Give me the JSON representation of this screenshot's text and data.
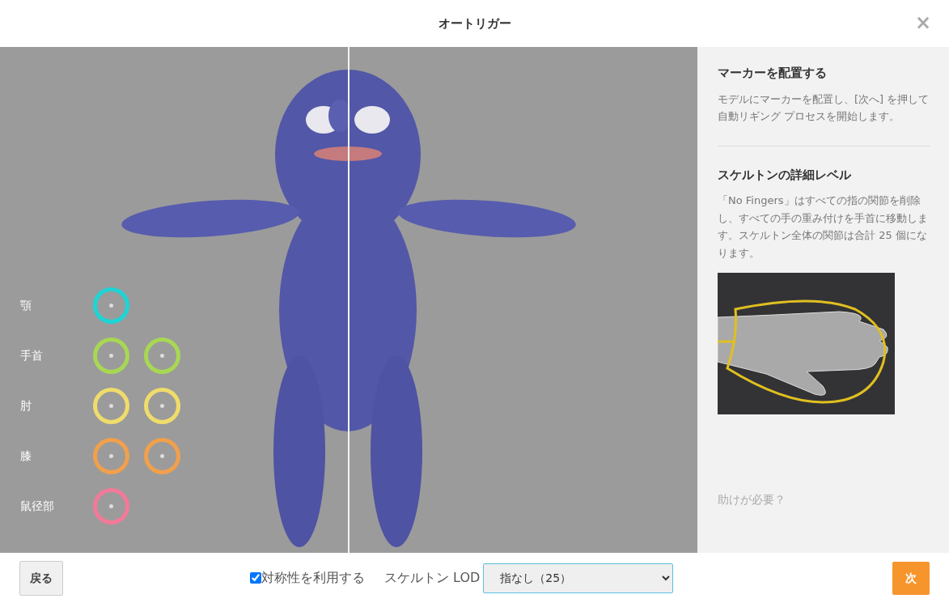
{
  "window": {
    "title": "オートリガー",
    "close": "×"
  },
  "markers": [
    {
      "label": "顎",
      "points": [
        {
          "color": "#1fd4d4"
        }
      ]
    },
    {
      "label": "手首",
      "points": [
        {
          "color": "#a8d853"
        },
        {
          "color": "#a8d853"
        }
      ]
    },
    {
      "label": "肘",
      "points": [
        {
          "color": "#efdc6b"
        },
        {
          "color": "#efdc6b"
        }
      ]
    },
    {
      "label": "膝",
      "points": [
        {
          "color": "#f1a04c"
        },
        {
          "color": "#f1a04c"
        }
      ]
    },
    {
      "label": "鼠径部",
      "points": [
        {
          "color": "#f27a98"
        }
      ]
    }
  ],
  "sidebar": {
    "sections": [
      {
        "title": "マーカーを配置する",
        "text": "モデルにマーカーを配置し、[次へ] を押して自動リギング プロセスを開始します。"
      },
      {
        "title": "スケルトンの詳細レベル",
        "text": "「No Fingers」はすべての指の関節を削除し、すべての手の重み付けを手首に移動します。スケルトン全体の関節は合計 25 個になります。"
      }
    ],
    "help_link": "助けが必要？"
  },
  "footer": {
    "back_button": "戻る",
    "symmetry": {
      "label": "対称性を利用する",
      "checked": true
    },
    "lod_label": "スケルトン LOD",
    "lod_value": "指なし（25）",
    "next_button": "次"
  }
}
